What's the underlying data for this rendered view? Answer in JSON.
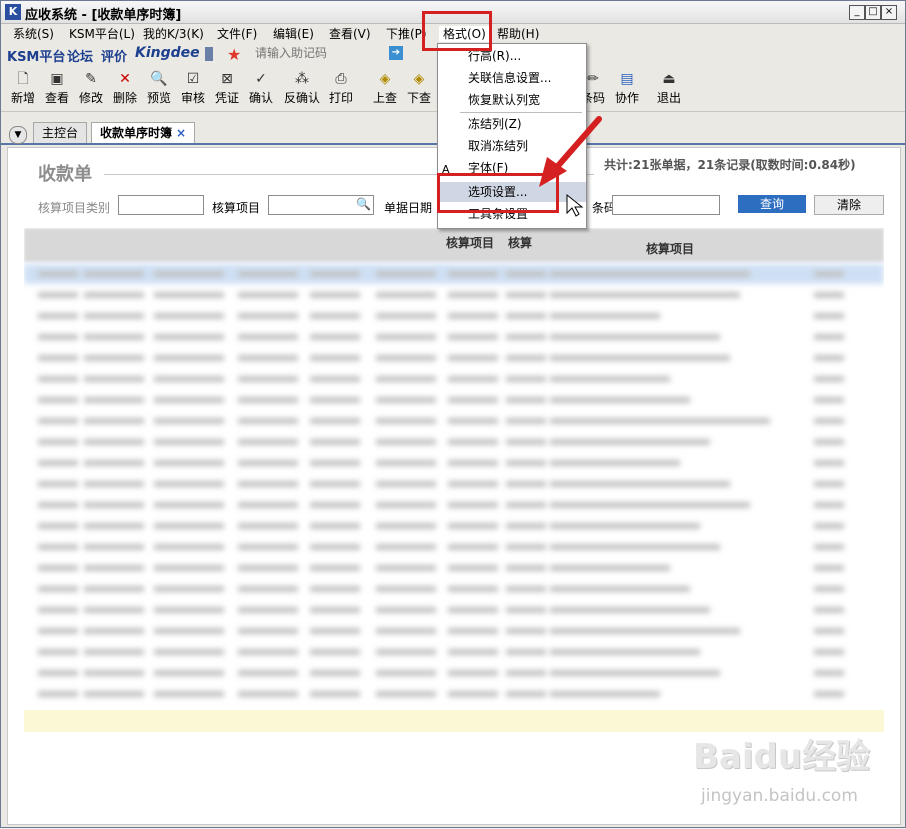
{
  "title": "应收系统 - [收款单序时簿]",
  "window_buttons": [
    "_",
    "□",
    "×"
  ],
  "menu": [
    "系统(S)",
    "KSM平台(L)",
    "我的K/3(K)",
    "文件(F)",
    "编辑(E)",
    "查看(V)",
    "下推(P)",
    "格式(O)",
    "帮助(H)"
  ],
  "quick_links": {
    "ksm": "KSM平台",
    "forum": "论坛",
    "review": "评价",
    "brand": "Kingdee",
    "assist_placeholder": "请输入助记码"
  },
  "toolbar": [
    "新增",
    "查看",
    "修改",
    "删除",
    "预览",
    "审核",
    "凭证",
    "确认",
    "反确认",
    "打印",
    "上查",
    "下查",
    "条码",
    "协作",
    "退出"
  ],
  "tabs": [
    "主控台",
    "收款单序时簿"
  ],
  "tab_close": "×",
  "form": {
    "title": "收款单",
    "summary": "共计:21张单据，21条记录(取数时间:0.84秒)",
    "label_category": "核算项目类别",
    "label_item": "核算项目",
    "label_date": "单据日期",
    "label_code": "条码",
    "btn_query": "查询",
    "btn_clear": "清除"
  },
  "grid": {
    "headers": [
      "核算项目",
      "核算",
      "核算项目"
    ]
  },
  "popup_menu": [
    "行高(R)...",
    "关联信息设置...",
    "恢复默认列宽",
    "冻结列(Z)",
    "取消冻结列",
    "字体(F)",
    "选项设置...",
    "工具条设置"
  ],
  "watermark": {
    "brand": "Baidu经验",
    "url": "jingyan.baidu.com"
  },
  "colors": {
    "highlight": "#d42020",
    "accent": "#2e6ec0",
    "selection": "#cfe0f5"
  }
}
